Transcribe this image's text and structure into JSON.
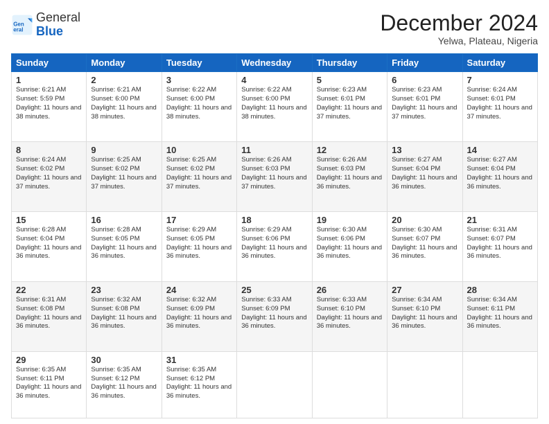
{
  "header": {
    "logo_general": "General",
    "logo_blue": "Blue",
    "month_title": "December 2024",
    "location": "Yelwa, Plateau, Nigeria"
  },
  "days_of_week": [
    "Sunday",
    "Monday",
    "Tuesday",
    "Wednesday",
    "Thursday",
    "Friday",
    "Saturday"
  ],
  "weeks": [
    [
      {
        "day": "1",
        "sunrise": "6:21 AM",
        "sunset": "5:59 PM",
        "daylight": "11 hours and 38 minutes."
      },
      {
        "day": "2",
        "sunrise": "6:21 AM",
        "sunset": "6:00 PM",
        "daylight": "11 hours and 38 minutes."
      },
      {
        "day": "3",
        "sunrise": "6:22 AM",
        "sunset": "6:00 PM",
        "daylight": "11 hours and 38 minutes."
      },
      {
        "day": "4",
        "sunrise": "6:22 AM",
        "sunset": "6:00 PM",
        "daylight": "11 hours and 38 minutes."
      },
      {
        "day": "5",
        "sunrise": "6:23 AM",
        "sunset": "6:01 PM",
        "daylight": "11 hours and 37 minutes."
      },
      {
        "day": "6",
        "sunrise": "6:23 AM",
        "sunset": "6:01 PM",
        "daylight": "11 hours and 37 minutes."
      },
      {
        "day": "7",
        "sunrise": "6:24 AM",
        "sunset": "6:01 PM",
        "daylight": "11 hours and 37 minutes."
      }
    ],
    [
      {
        "day": "8",
        "sunrise": "6:24 AM",
        "sunset": "6:02 PM",
        "daylight": "11 hours and 37 minutes."
      },
      {
        "day": "9",
        "sunrise": "6:25 AM",
        "sunset": "6:02 PM",
        "daylight": "11 hours and 37 minutes."
      },
      {
        "day": "10",
        "sunrise": "6:25 AM",
        "sunset": "6:02 PM",
        "daylight": "11 hours and 37 minutes."
      },
      {
        "day": "11",
        "sunrise": "6:26 AM",
        "sunset": "6:03 PM",
        "daylight": "11 hours and 37 minutes."
      },
      {
        "day": "12",
        "sunrise": "6:26 AM",
        "sunset": "6:03 PM",
        "daylight": "11 hours and 36 minutes."
      },
      {
        "day": "13",
        "sunrise": "6:27 AM",
        "sunset": "6:04 PM",
        "daylight": "11 hours and 36 minutes."
      },
      {
        "day": "14",
        "sunrise": "6:27 AM",
        "sunset": "6:04 PM",
        "daylight": "11 hours and 36 minutes."
      }
    ],
    [
      {
        "day": "15",
        "sunrise": "6:28 AM",
        "sunset": "6:04 PM",
        "daylight": "11 hours and 36 minutes."
      },
      {
        "day": "16",
        "sunrise": "6:28 AM",
        "sunset": "6:05 PM",
        "daylight": "11 hours and 36 minutes."
      },
      {
        "day": "17",
        "sunrise": "6:29 AM",
        "sunset": "6:05 PM",
        "daylight": "11 hours and 36 minutes."
      },
      {
        "day": "18",
        "sunrise": "6:29 AM",
        "sunset": "6:06 PM",
        "daylight": "11 hours and 36 minutes."
      },
      {
        "day": "19",
        "sunrise": "6:30 AM",
        "sunset": "6:06 PM",
        "daylight": "11 hours and 36 minutes."
      },
      {
        "day": "20",
        "sunrise": "6:30 AM",
        "sunset": "6:07 PM",
        "daylight": "11 hours and 36 minutes."
      },
      {
        "day": "21",
        "sunrise": "6:31 AM",
        "sunset": "6:07 PM",
        "daylight": "11 hours and 36 minutes."
      }
    ],
    [
      {
        "day": "22",
        "sunrise": "6:31 AM",
        "sunset": "6:08 PM",
        "daylight": "11 hours and 36 minutes."
      },
      {
        "day": "23",
        "sunrise": "6:32 AM",
        "sunset": "6:08 PM",
        "daylight": "11 hours and 36 minutes."
      },
      {
        "day": "24",
        "sunrise": "6:32 AM",
        "sunset": "6:09 PM",
        "daylight": "11 hours and 36 minutes."
      },
      {
        "day": "25",
        "sunrise": "6:33 AM",
        "sunset": "6:09 PM",
        "daylight": "11 hours and 36 minutes."
      },
      {
        "day": "26",
        "sunrise": "6:33 AM",
        "sunset": "6:10 PM",
        "daylight": "11 hours and 36 minutes."
      },
      {
        "day": "27",
        "sunrise": "6:34 AM",
        "sunset": "6:10 PM",
        "daylight": "11 hours and 36 minutes."
      },
      {
        "day": "28",
        "sunrise": "6:34 AM",
        "sunset": "6:11 PM",
        "daylight": "11 hours and 36 minutes."
      }
    ],
    [
      {
        "day": "29",
        "sunrise": "6:35 AM",
        "sunset": "6:11 PM",
        "daylight": "11 hours and 36 minutes."
      },
      {
        "day": "30",
        "sunrise": "6:35 AM",
        "sunset": "6:12 PM",
        "daylight": "11 hours and 36 minutes."
      },
      {
        "day": "31",
        "sunrise": "6:35 AM",
        "sunset": "6:12 PM",
        "daylight": "11 hours and 36 minutes."
      },
      null,
      null,
      null,
      null
    ]
  ]
}
